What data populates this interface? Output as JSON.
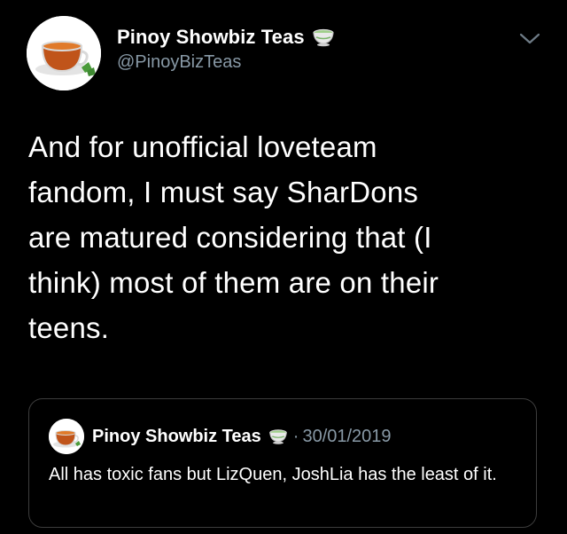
{
  "tweet": {
    "display_name": "Pinoy Showbiz Teas",
    "handle": "@PinoyBizTeas",
    "text": "And for unofficial loveteam\nfandom, I must say SharDons\nare matured considering that (I\nthink) most of them are on their\nteens.",
    "name_emoji_icon": "green-tea-cup-icon",
    "menu_icon": "chevron-down-icon",
    "avatar_icon": "tea-cup-avatar"
  },
  "quoted_tweet": {
    "display_name": "Pinoy Showbiz Teas",
    "separator": "·",
    "date": "30/01/2019",
    "text": "All has toxic fans but LizQuen, JoshLia has the least of it.",
    "name_emoji_icon": "green-tea-cup-icon",
    "avatar_icon": "tea-cup-avatar"
  },
  "colors": {
    "background": "#000000",
    "primary_text": "#ffffff",
    "secondary_text": "#8899a6",
    "card_border": "#3d3d3d",
    "tea": "#c0541a",
    "cup_green": "#9fcf8a"
  }
}
